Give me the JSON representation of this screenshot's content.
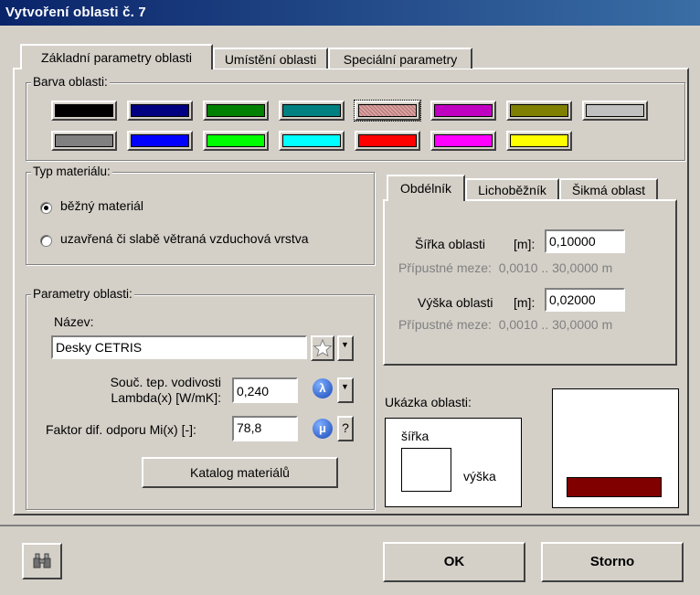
{
  "window": {
    "title": "Vytvoření oblasti č. 7"
  },
  "tabs": [
    {
      "label": "Základní parametry oblasti",
      "active": true
    },
    {
      "label": "Umístění oblasti",
      "active": false
    },
    {
      "label": "Speciální parametry",
      "active": false
    }
  ],
  "color_group": {
    "label": "Barva oblasti:",
    "swatches_row1": [
      "#000000",
      "#000080",
      "#008000",
      "#008080",
      "#e0a0a0",
      "#c000c0",
      "#808000",
      "#c0c0c0"
    ],
    "swatches_row2": [
      "#808080",
      "#0000ff",
      "#00ff00",
      "#00ffff",
      "#ff0000",
      "#ff00ff",
      "#ffff00"
    ],
    "selected_index": 4
  },
  "material_type": {
    "label": "Typ materiálu:",
    "options": [
      {
        "label": "běžný materiál",
        "selected": true
      },
      {
        "label": "uzavřená či slabě větraná vzduchová vrstva",
        "selected": false
      }
    ]
  },
  "params": {
    "label": "Parametry oblasti:",
    "name_label": "Název:",
    "name_value": "Desky CETRIS",
    "lambda_label_1": "Souč. tep. vodivosti",
    "lambda_label_2": "Lambda(x) [W/mK]:",
    "lambda_value": "0,240",
    "lambda_icon_text": "λ",
    "mi_label": "Faktor dif. odporu Mi(x) [-]:",
    "mi_value": "78,8",
    "mi_icon_text": "μ",
    "help_text": "?",
    "catalog_button": "Katalog materiálů"
  },
  "shape_tabs": [
    {
      "label": "Obdélník",
      "active": true
    },
    {
      "label": "Lichoběžník",
      "active": false
    },
    {
      "label": "Šikmá oblast",
      "active": false
    }
  ],
  "shape": {
    "width_label": "Šířka oblasti",
    "unit": "[m]:",
    "width_value": "0,10000",
    "width_limits": "Přípustné meze:  0,0010 .. 30,0000 m",
    "height_label": "Výška oblasti",
    "height_value": "0,02000",
    "height_limits": "Přípustné meze:  0,0010 .. 30,0000 m"
  },
  "preview": {
    "label": "Ukázka oblasti:",
    "width_text": "šířka",
    "height_text": "výška",
    "bar_color": "#800000"
  },
  "footer": {
    "ok": "OK",
    "cancel": "Storno"
  }
}
